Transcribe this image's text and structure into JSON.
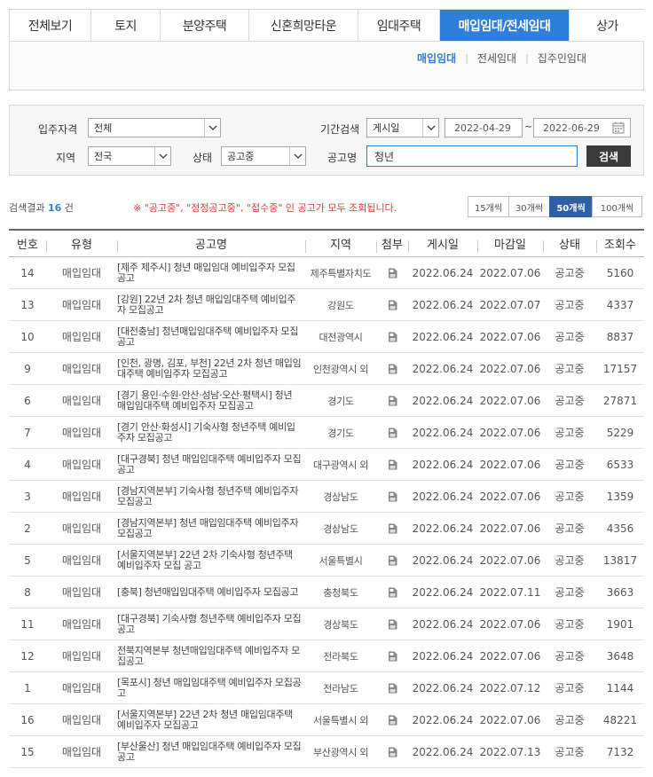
{
  "tabs": [
    "전체보기",
    "토지",
    "분양주택",
    "신혼희망타운",
    "임대주택",
    "매입임대/전세임대",
    "상가"
  ],
  "active_tab": 5,
  "subtabs": [
    "매입임대",
    "전세임대",
    "집주인임대"
  ],
  "active_subtab": 0,
  "search": {
    "label_qualification": "입주자격",
    "qualification_value": "전체",
    "label_period": "기간검색",
    "period_type": "게시일",
    "date_from": "2022-04-29",
    "date_sep": "~",
    "date_to": "2022-06-29",
    "label_region": "지역",
    "region_value": "전국",
    "label_status": "상태",
    "status_value": "공고중",
    "label_title": "공고명",
    "title_value": "청년",
    "search_button": "검색"
  },
  "results": {
    "prefix": "검색결과",
    "count": "16",
    "suffix": "건",
    "notice": "※ \"공고중\", \"정정공고중\", \"접수중\" 인 공고가 모두 조회됩니다.",
    "page_sizes": [
      "15개씩",
      "30개씩",
      "50개씩",
      "100개씩"
    ],
    "active_page_size": 2
  },
  "table": {
    "headers": [
      "번호",
      "유형",
      "공고명",
      "지역",
      "첨부",
      "게시일",
      "마감일",
      "상태",
      "조회수"
    ],
    "rows": [
      {
        "no": "14",
        "type": "매입임대",
        "title": "[제주 제주시] 청년 매입임대 예비입주자 모집 공고",
        "region": "제주특별자치도",
        "posted": "2022.06.24",
        "deadline": "2022.07.06",
        "status": "공고중",
        "views": "5160"
      },
      {
        "no": "13",
        "type": "매입임대",
        "title": "[강원] 22년 2차 청년 매입임대주택 예비입주자 모집공고",
        "region": "강원도",
        "posted": "2022.06.24",
        "deadline": "2022.07.07",
        "status": "공고중",
        "views": "4337"
      },
      {
        "no": "10",
        "type": "매입임대",
        "title": "[대전충남] 청년매입임대주택 예비입주자 모집공고",
        "region": "대전광역시",
        "posted": "2022.06.24",
        "deadline": "2022.07.06",
        "status": "공고중",
        "views": "8837"
      },
      {
        "no": "9",
        "type": "매입임대",
        "title": "[인천, 광명, 김포, 부천] 22년 2차 청년 매입임대주택 예비입주자 모집공고",
        "region": "인천광역시 외",
        "posted": "2022.06.24",
        "deadline": "2022.07.06",
        "status": "공고중",
        "views": "17157"
      },
      {
        "no": "6",
        "type": "매입임대",
        "title": "[경기 용인·수원·안산·성남·오산·평택시] 청년 매입임대주택 예비입주자 모집공고",
        "region": "경기도",
        "posted": "2022.06.24",
        "deadline": "2022.07.06",
        "status": "공고중",
        "views": "27871"
      },
      {
        "no": "7",
        "type": "매입임대",
        "title": "[경기 안산·화성시] 기숙사형 청년주택 예비입주자 모집공고",
        "region": "경기도",
        "posted": "2022.06.24",
        "deadline": "2022.07.06",
        "status": "공고중",
        "views": "5229"
      },
      {
        "no": "4",
        "type": "매입임대",
        "title": "[대구경북] 청년 매입임대주택 예비입주자 모집공고",
        "region": "대구광역시 외",
        "posted": "2022.06.24",
        "deadline": "2022.07.06",
        "status": "공고중",
        "views": "6533"
      },
      {
        "no": "3",
        "type": "매입임대",
        "title": "[경남지역본부] 기숙사형 청년주택 예비입주자 모집공고",
        "region": "경상남도",
        "posted": "2022.06.24",
        "deadline": "2022.07.06",
        "status": "공고중",
        "views": "1359"
      },
      {
        "no": "2",
        "type": "매입임대",
        "title": "[경남지역본부] 청년 매입임대주택 예비입주자 모집공고",
        "region": "경상남도",
        "posted": "2022.06.24",
        "deadline": "2022.07.06",
        "status": "공고중",
        "views": "4356"
      },
      {
        "no": "5",
        "type": "매입임대",
        "title": "[서울지역본부] 22년 2차 기숙사형 청년주택 예비입주자 모집 공고",
        "region": "서울특별시",
        "posted": "2022.06.24",
        "deadline": "2022.07.06",
        "status": "공고중",
        "views": "13817"
      },
      {
        "no": "8",
        "type": "매입임대",
        "title": "[충북] 청년매입임대주택 예비입주자 모집공고",
        "region": "충청북도",
        "posted": "2022.06.24",
        "deadline": "2022.07.11",
        "status": "공고중",
        "views": "3663"
      },
      {
        "no": "11",
        "type": "매입임대",
        "title": "[대구경북] 기숙사형 청년주택 예비입주자 모집공고",
        "region": "경상북도",
        "posted": "2022.06.24",
        "deadline": "2022.07.06",
        "status": "공고중",
        "views": "1901"
      },
      {
        "no": "12",
        "type": "매입임대",
        "title": "전북지역본부 청년매입임대주택 예비입주자 모집공고",
        "region": "전라북도",
        "posted": "2022.06.24",
        "deadline": "2022.07.06",
        "status": "공고중",
        "views": "3648"
      },
      {
        "no": "1",
        "type": "매입임대",
        "title": "[목포시] 청년 매입임대주택 예비입주자 모집공고",
        "region": "전라남도",
        "posted": "2022.06.24",
        "deadline": "2022.07.12",
        "status": "공고중",
        "views": "1144"
      },
      {
        "no": "16",
        "type": "매입임대",
        "title": "[서울지역본부] 22년 2차 청년 매입임대주택 예비입주자 모집공고",
        "region": "서울특별시 외",
        "posted": "2022.06.24",
        "deadline": "2022.07.06",
        "status": "공고중",
        "views": "48221"
      },
      {
        "no": "15",
        "type": "매입임대",
        "title": "[부산울산] 청년 매입임대주택 예비입주자 모집공고",
        "region": "부산광역시 외",
        "posted": "2022.06.24",
        "deadline": "2022.07.13",
        "status": "공고중",
        "views": "7132"
      }
    ]
  },
  "colors": {
    "accent": "#2f7fd8",
    "notice": "#e23b3b",
    "page_active": "#2f5fa5",
    "search_button": "#3a3a3a"
  },
  "icons": {
    "attachment": "file-icon",
    "dropdown": "chevron-down-icon",
    "calendar": "calendar-icon"
  }
}
